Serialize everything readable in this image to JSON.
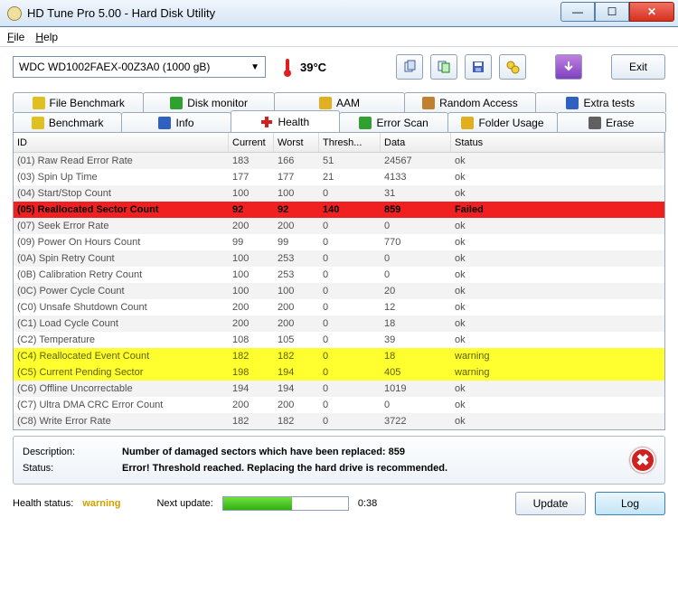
{
  "window": {
    "title": "HD Tune Pro 5.00 - Hard Disk Utility"
  },
  "menu": {
    "file": "File",
    "help": "Help"
  },
  "drive": {
    "selected": "WDC WD1002FAEX-00Z3A0 (1000 gB)",
    "temperature": "39°C"
  },
  "toolbar": {
    "exit": "Exit"
  },
  "tabs": {
    "row1": [
      "File Benchmark",
      "Disk monitor",
      "AAM",
      "Random Access",
      "Extra tests"
    ],
    "row2": [
      "Benchmark",
      "Info",
      "Health",
      "Error Scan",
      "Folder Usage",
      "Erase"
    ],
    "active": "Health"
  },
  "columns": {
    "id": "ID",
    "current": "Current",
    "worst": "Worst",
    "thresh": "Thresh...",
    "data": "Data",
    "status": "Status"
  },
  "rows": [
    {
      "id": "(01) Raw Read Error Rate",
      "cur": "183",
      "wor": "166",
      "thr": "51",
      "dat": "24567",
      "sta": "ok",
      "cls": ""
    },
    {
      "id": "(03) Spin Up Time",
      "cur": "177",
      "wor": "177",
      "thr": "21",
      "dat": "4133",
      "sta": "ok",
      "cls": ""
    },
    {
      "id": "(04) Start/Stop Count",
      "cur": "100",
      "wor": "100",
      "thr": "0",
      "dat": "31",
      "sta": "ok",
      "cls": ""
    },
    {
      "id": "(05) Reallocated Sector Count",
      "cur": "92",
      "wor": "92",
      "thr": "140",
      "dat": "859",
      "sta": "Failed",
      "cls": "failed"
    },
    {
      "id": "(07) Seek Error Rate",
      "cur": "200",
      "wor": "200",
      "thr": "0",
      "dat": "0",
      "sta": "ok",
      "cls": ""
    },
    {
      "id": "(09) Power On Hours Count",
      "cur": "99",
      "wor": "99",
      "thr": "0",
      "dat": "770",
      "sta": "ok",
      "cls": ""
    },
    {
      "id": "(0A) Spin Retry Count",
      "cur": "100",
      "wor": "253",
      "thr": "0",
      "dat": "0",
      "sta": "ok",
      "cls": ""
    },
    {
      "id": "(0B) Calibration Retry Count",
      "cur": "100",
      "wor": "253",
      "thr": "0",
      "dat": "0",
      "sta": "ok",
      "cls": ""
    },
    {
      "id": "(0C) Power Cycle Count",
      "cur": "100",
      "wor": "100",
      "thr": "0",
      "dat": "20",
      "sta": "ok",
      "cls": ""
    },
    {
      "id": "(C0) Unsafe Shutdown Count",
      "cur": "200",
      "wor": "200",
      "thr": "0",
      "dat": "12",
      "sta": "ok",
      "cls": ""
    },
    {
      "id": "(C1) Load Cycle Count",
      "cur": "200",
      "wor": "200",
      "thr": "0",
      "dat": "18",
      "sta": "ok",
      "cls": ""
    },
    {
      "id": "(C2) Temperature",
      "cur": "108",
      "wor": "105",
      "thr": "0",
      "dat": "39",
      "sta": "ok",
      "cls": ""
    },
    {
      "id": "(C4) Reallocated Event Count",
      "cur": "182",
      "wor": "182",
      "thr": "0",
      "dat": "18",
      "sta": "warning",
      "cls": "warning"
    },
    {
      "id": "(C5) Current Pending Sector",
      "cur": "198",
      "wor": "194",
      "thr": "0",
      "dat": "405",
      "sta": "warning",
      "cls": "warning"
    },
    {
      "id": "(C6) Offline Uncorrectable",
      "cur": "194",
      "wor": "194",
      "thr": "0",
      "dat": "1019",
      "sta": "ok",
      "cls": ""
    },
    {
      "id": "(C7) Ultra DMA CRC Error Count",
      "cur": "200",
      "wor": "200",
      "thr": "0",
      "dat": "0",
      "sta": "ok",
      "cls": ""
    },
    {
      "id": "(C8) Write Error Rate",
      "cur": "182",
      "wor": "182",
      "thr": "0",
      "dat": "3722",
      "sta": "ok",
      "cls": ""
    }
  ],
  "info": {
    "desc_label": "Description:",
    "status_label": "Status:",
    "desc": "Number of damaged sectors which have been replaced: 859",
    "status": "Error! Threshold reached. Replacing the hard drive is recommended."
  },
  "footer": {
    "health_label": "Health status:",
    "health_value": "warning",
    "next_label": "Next update:",
    "progress_pct": 55,
    "time": "0:38",
    "update": "Update",
    "log": "Log"
  }
}
